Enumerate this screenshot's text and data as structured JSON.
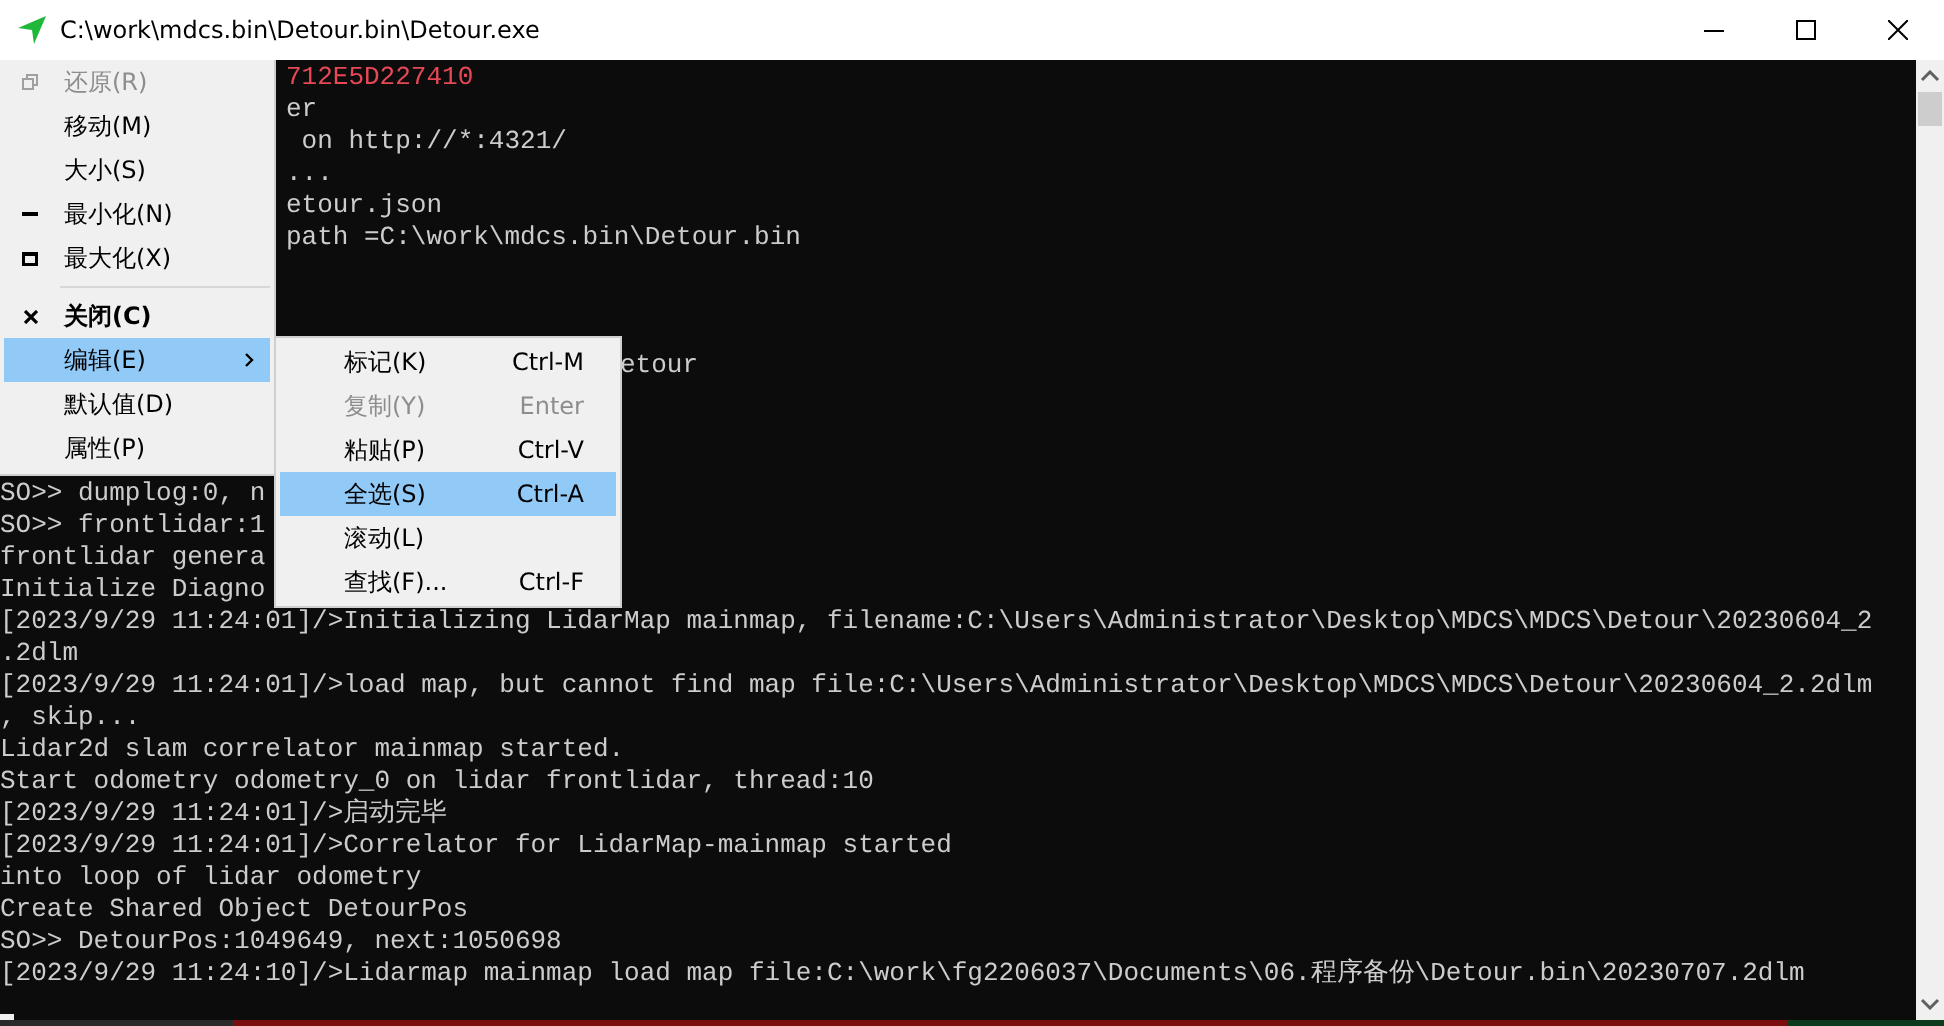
{
  "window": {
    "title": "C:\\work\\mdcs.bin\\Detour.bin\\Detour.exe"
  },
  "console": {
    "lines": [
      {
        "kind": "after_menu",
        "text": "712E5D227410",
        "color": "#e74856"
      },
      {
        "kind": "after_menu",
        "text": "er"
      },
      {
        "kind": "after_menu",
        "text": " on http://*:4321/"
      },
      {
        "kind": "after_menu",
        "text": "..."
      },
      {
        "kind": "after_menu",
        "text": "etour.json"
      },
      {
        "kind": "after_menu",
        "text": "path =C:\\work\\mdcs.bin\\Detour.bin"
      },
      {
        "kind": "blank"
      },
      {
        "kind": "blank"
      },
      {
        "kind": "blank"
      },
      {
        "kind": "after_submenu",
        "text": "etour"
      },
      {
        "kind": "blank"
      },
      {
        "kind": "blank"
      },
      {
        "kind": "blank"
      },
      {
        "kind": "full",
        "text": "SO>> dumplog:0, n"
      },
      {
        "kind": "full",
        "text": "SO>> frontlidar:1"
      },
      {
        "kind": "full",
        "text": "frontlidar genera"
      },
      {
        "kind": "full",
        "text": "Initialize Diagno"
      },
      {
        "kind": "full",
        "text": "[2023/9/29 11:24:01]/>Initializing LidarMap mainmap, filename:C:\\Users\\Administrator\\Desktop\\MDCS\\MDCS\\Detour\\20230604_2"
      },
      {
        "kind": "full",
        "text": ".2dlm"
      },
      {
        "kind": "full",
        "text": "[2023/9/29 11:24:01]/>load map, but cannot find map file:C:\\Users\\Administrator\\Desktop\\MDCS\\MDCS\\Detour\\20230604_2.2dlm"
      },
      {
        "kind": "full",
        "text": ", skip..."
      },
      {
        "kind": "full",
        "text": "Lidar2d slam correlator mainmap started."
      },
      {
        "kind": "full",
        "text": "Start odometry odometry_0 on lidar frontlidar, thread:10"
      },
      {
        "kind": "full",
        "text": "[2023/9/29 11:24:01]/>启动完毕"
      },
      {
        "kind": "full",
        "text": "[2023/9/29 11:24:01]/>Correlator for LidarMap-mainmap started"
      },
      {
        "kind": "full",
        "text": "into loop of lidar odometry"
      },
      {
        "kind": "full",
        "text": "Create Shared Object DetourPos"
      },
      {
        "kind": "full",
        "text": "SO>> DetourPos:1049649, next:1050698"
      },
      {
        "kind": "full",
        "text": "[2023/9/29 11:24:10]/>Lidarmap mainmap load map file:C:\\work\\fg2206037\\Documents\\06.程序备份\\Detour.bin\\20230707.2dlm"
      },
      {
        "kind": "cursor"
      }
    ]
  },
  "system_menu": {
    "items": [
      {
        "kind": "restore",
        "label": "还原(R)",
        "disabled": true,
        "bold": false,
        "selected": false
      },
      {
        "kind": "item",
        "label": "移动(M)",
        "disabled": false,
        "bold": false,
        "selected": false
      },
      {
        "kind": "item",
        "label": "大小(S)",
        "disabled": false,
        "bold": false,
        "selected": false
      },
      {
        "kind": "minimize",
        "label": "最小化(N)",
        "disabled": false,
        "bold": false,
        "selected": false
      },
      {
        "kind": "maximize",
        "label": "最大化(X)",
        "disabled": false,
        "bold": false,
        "selected": false
      },
      {
        "kind": "separator"
      },
      {
        "kind": "close",
        "label": "关闭(C)",
        "disabled": false,
        "bold": true,
        "selected": false
      },
      {
        "kind": "submenu",
        "label": "编辑(E)",
        "disabled": false,
        "bold": false,
        "selected": true
      },
      {
        "kind": "item",
        "label": "默认值(D)",
        "disabled": false,
        "bold": false,
        "selected": false
      },
      {
        "kind": "item",
        "label": "属性(P)",
        "disabled": false,
        "bold": false,
        "selected": false
      }
    ]
  },
  "edit_submenu": {
    "items": [
      {
        "label": "标记(K)",
        "shortcut": "Ctrl-M",
        "disabled": false,
        "selected": false
      },
      {
        "label": "复制(Y)",
        "shortcut": "Enter",
        "disabled": true,
        "selected": false
      },
      {
        "label": "粘贴(P)",
        "shortcut": "Ctrl-V",
        "disabled": false,
        "selected": false
      },
      {
        "label": "全选(S)",
        "shortcut": "Ctrl-A",
        "disabled": false,
        "selected": true
      },
      {
        "label": "滚动(L)",
        "disabled": false,
        "selected": false
      },
      {
        "label": "查找(F)...",
        "shortcut": "Ctrl-F",
        "disabled": false,
        "selected": false
      }
    ]
  }
}
